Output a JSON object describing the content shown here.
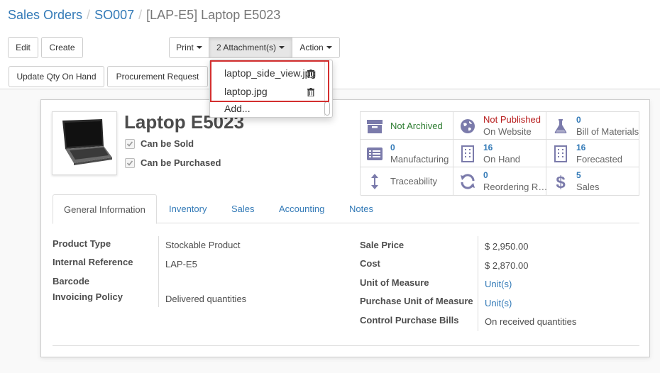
{
  "breadcrumb": {
    "items": [
      "Sales Orders",
      "SO007"
    ],
    "separator": "/",
    "current": "[LAP-E5] Laptop E5023"
  },
  "toolbar": {
    "edit_label": "Edit",
    "create_label": "Create",
    "print_label": "Print",
    "attachments_label": "2 Attachment(s)",
    "action_label": "Action",
    "update_qty_label": "Update Qty On Hand",
    "procurement_label": "Procurement Request"
  },
  "attachments_menu": {
    "items": [
      {
        "name": "laptop_side_view.jpg"
      },
      {
        "name": "laptop.jpg"
      }
    ],
    "add_label": "Add..."
  },
  "product": {
    "name": "Laptop E5023",
    "can_be_sold": "Can be Sold",
    "can_be_purchased": "Can be Purchased"
  },
  "smart_buttons": [
    {
      "id": "archive",
      "single": "Not Archived",
      "single_color": "#2e7d32",
      "icon": "archive-icon"
    },
    {
      "id": "website",
      "value": "Not Published",
      "value_color": "#b71c1c",
      "label": "On Website",
      "icon": "globe-icon"
    },
    {
      "id": "bom",
      "value": "0",
      "label": "Bill of Materials",
      "icon": "flask-icon"
    },
    {
      "id": "manufacturing",
      "value": "0",
      "label": "Manufacturing",
      "icon": "list-icon"
    },
    {
      "id": "onhand",
      "value": "16",
      "label": "On Hand",
      "icon": "building-icon"
    },
    {
      "id": "forecasted",
      "value": "16",
      "label": "Forecasted",
      "icon": "building-icon"
    },
    {
      "id": "traceability",
      "single": "Traceability",
      "single_color": "#666666",
      "icon": "arrows-vertical-icon"
    },
    {
      "id": "reordering",
      "value": "0",
      "label": "Reordering R…",
      "icon": "refresh-icon"
    },
    {
      "id": "sales",
      "value": "5",
      "label": "Sales",
      "icon": "dollar-icon"
    }
  ],
  "tabs": [
    "General Information",
    "Inventory",
    "Sales",
    "Accounting",
    "Notes"
  ],
  "fields_left": [
    {
      "label": "Product Type",
      "value": "Stockable Product"
    },
    {
      "label": "Internal Reference",
      "value": "LAP-E5"
    },
    {
      "label": "Barcode",
      "value": ""
    },
    {
      "label": "Invoicing Policy",
      "value": "Delivered quantities"
    }
  ],
  "fields_right": [
    {
      "label": "Sale Price",
      "value": "$ 2,950.00"
    },
    {
      "label": "Cost",
      "value": "$ 2,870.00"
    },
    {
      "label": "Unit of Measure",
      "value": "Unit(s)"
    },
    {
      "label": "Purchase Unit of Measure",
      "value": "Unit(s)"
    },
    {
      "label": "Control Purchase Bills",
      "value": "On received quantities"
    }
  ],
  "colors": {
    "link": "#337ab7",
    "highlight": "#d32f2f",
    "icon": "#7b7bab"
  }
}
